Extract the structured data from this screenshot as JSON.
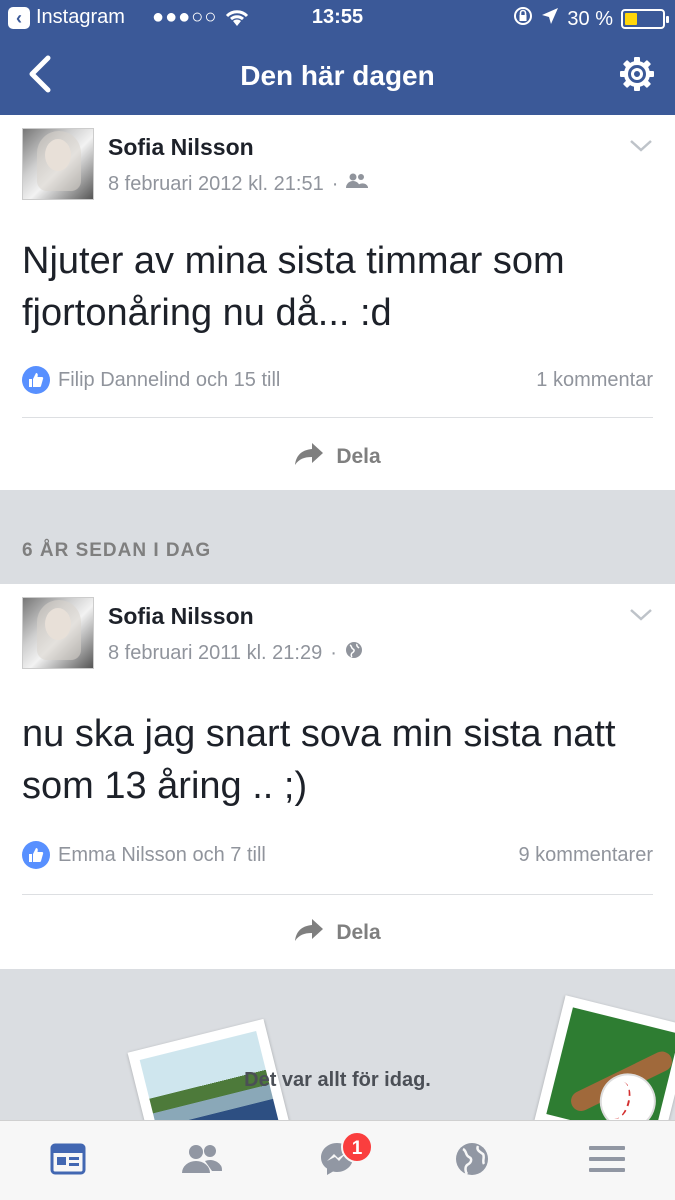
{
  "status_bar": {
    "back_app": "Instagram",
    "signal": "●●●○○",
    "time": "13:55",
    "battery": "30 %"
  },
  "nav": {
    "title": "Den här dagen"
  },
  "posts": [
    {
      "author": "Sofia Nilsson",
      "timestamp": "8 februari 2012 kl. 21:51",
      "privacy_icon": "friends-icon",
      "text": "Njuter av mina sista timmar som fjortonåring nu då... :d",
      "likes": "Filip Dannelind och 15 till",
      "comments": "1 kommentar",
      "share_label": "Dela"
    },
    {
      "author": "Sofia Nilsson",
      "timestamp": "8 februari 2011 kl. 21:29",
      "privacy_icon": "globe-icon",
      "text": "nu ska jag snart sova min sista natt som 13 åring .. ;)",
      "likes": "Emma Nilsson och 7 till",
      "comments": "9 kommentarer",
      "share_label": "Dela"
    }
  ],
  "section_label": "6 ÅR SEDAN I DAG",
  "end_message": "Det var allt för idag.",
  "tabbar": {
    "items": [
      "news-feed-icon",
      "friends-icon",
      "messenger-icon",
      "notifications-globe-icon",
      "menu-icon"
    ],
    "messenger_badge": "1"
  },
  "colors": {
    "brand": "#3b5998",
    "like_blue": "#5890ff",
    "badge_red": "#fa3e3e"
  }
}
